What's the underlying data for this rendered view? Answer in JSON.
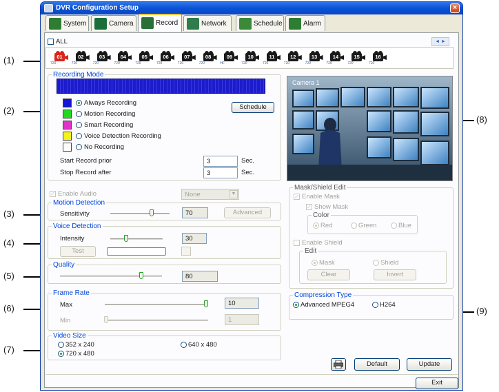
{
  "window": {
    "title": "DVR Configuration Setup",
    "close": "×"
  },
  "tabs": [
    {
      "label": "System",
      "icon": "system-icon",
      "color": "#2e7d32"
    },
    {
      "label": "Camera",
      "icon": "camera-icon",
      "color": "#1b6e3a"
    },
    {
      "label": "Record",
      "icon": "record-icon",
      "color": "#2a6f36",
      "active": true
    },
    {
      "label": "Network",
      "icon": "network-icon",
      "color": "#2f7d4a"
    },
    {
      "label": "Schedule",
      "icon": "schedule-icon",
      "color": "#3a8a3a"
    },
    {
      "label": "Alarm",
      "icon": "alarm-icon",
      "color": "#2e7d32"
    }
  ],
  "all_label": "ALL",
  "nav_arrows": "◄ ►",
  "cameras": [
    {
      "num": "01",
      "res": "720",
      "selected": true
    },
    {
      "num": "02",
      "res": "720"
    },
    {
      "num": "03",
      "res": "720"
    },
    {
      "num": "04",
      "res": "720"
    },
    {
      "num": "05",
      "res": "720"
    },
    {
      "num": "06",
      "res": "720"
    },
    {
      "num": "07",
      "res": "720"
    },
    {
      "num": "08",
      "res": "720"
    },
    {
      "num": "09",
      "res": "HF"
    },
    {
      "num": "10",
      "res": "720"
    },
    {
      "num": "11",
      "res": "720"
    },
    {
      "num": "12",
      "res": "720"
    },
    {
      "num": "13",
      "res": "720"
    },
    {
      "num": "14",
      "res": "720"
    },
    {
      "num": "15",
      "res": "720"
    },
    {
      "num": "16",
      "res": "720"
    }
  ],
  "recording_mode": {
    "label": "Recording Mode",
    "timeline_color": "#1c1ccc",
    "schedule_button": "Schedule",
    "options": [
      {
        "label": "Always Recording",
        "color": "#1515d6",
        "selected": true
      },
      {
        "label": "Motion Recording",
        "color": "#22d822"
      },
      {
        "label": "Smart Recording",
        "color": "#e033c8"
      },
      {
        "label": "Voice Detection Recording",
        "color": "#f2f21e"
      },
      {
        "label": "No Recording",
        "color": "#ffffff"
      }
    ],
    "start_prior_label": "Start Record prior",
    "start_prior_value": "3",
    "stop_after_label": "Stop Record after",
    "stop_after_value": "3",
    "unit": "Sec."
  },
  "camera_preview": {
    "caption": "Camera 1"
  },
  "audio": {
    "label": "Enable Audio",
    "select_value": "None"
  },
  "motion_detection": {
    "label": "Motion Detection",
    "sensitivity_label": "Sensitivity",
    "sensitivity_value": "70",
    "sensitivity_level": 0.7,
    "advanced_button": "Advanced"
  },
  "voice_detection": {
    "label": "Voice Detection",
    "intensity_label": "Intensity",
    "intensity_value": "30",
    "intensity_level": 0.3,
    "test_button": "Test"
  },
  "quality": {
    "label": "Quality",
    "value": "80",
    "level": 0.8
  },
  "frame_rate": {
    "label": "Frame Rate",
    "max_label": "Max",
    "max_value": "10",
    "min_label": "Min",
    "min_value": "1"
  },
  "video_size": {
    "label": "Video Size",
    "options": [
      {
        "label": "352 x 240"
      },
      {
        "label": "640 x 480"
      },
      {
        "label": "720 x 480",
        "selected": true
      }
    ]
  },
  "mask_shield": {
    "label": "Mask/Shield Edit",
    "enable_mask": "Enable Mask",
    "show_mask": "Show Mask",
    "color_label": "Color",
    "colors": [
      "Red",
      "Green",
      "Blue"
    ],
    "enable_shield": "Enable Shield",
    "edit_label": "Edit",
    "edit_modes": [
      "Mask",
      "Shield"
    ],
    "clear_button": "Clear",
    "invert_button": "Invert"
  },
  "compression": {
    "label": "Compression Type",
    "options": [
      {
        "label": "Advanced MPEG4",
        "selected": true
      },
      {
        "label": "H264"
      }
    ]
  },
  "footer": {
    "default_button": "Default",
    "update_button": "Update",
    "exit_button": "Exit"
  },
  "callouts": [
    "(1)",
    "(2)",
    "(3)",
    "(4)",
    "(5)",
    "(6)",
    "(7)",
    "(8)",
    "(9)"
  ]
}
